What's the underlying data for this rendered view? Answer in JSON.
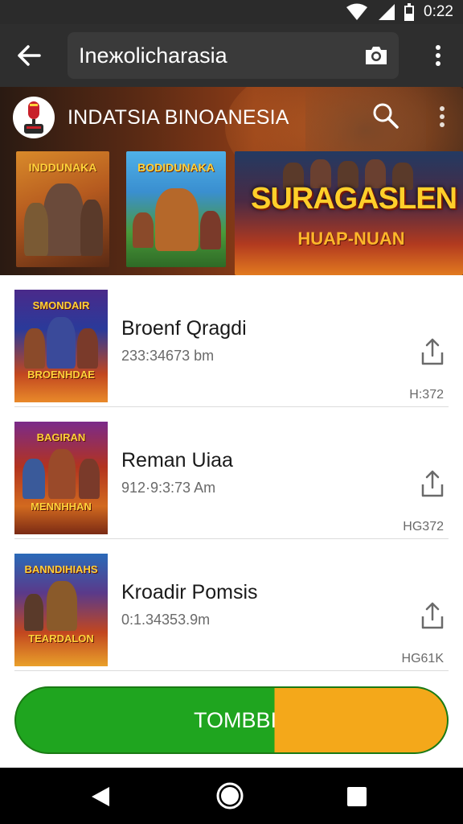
{
  "status_bar": {
    "time": "0:22",
    "icons": [
      "wifi-icon",
      "signal-icon",
      "battery-icon"
    ]
  },
  "app_bar": {
    "search_value": "Ineжolicharasia",
    "icons": [
      "back-arrow-icon",
      "camera-icon",
      "more-vert-icon"
    ]
  },
  "banner": {
    "channel_title": "INDATSIA BINOANESIA",
    "posters": [
      {
        "title": "INDDUNAKA"
      },
      {
        "title": "BODIDUNAKA"
      },
      {
        "title": "SURAGASLEN",
        "subtitle": "HUAP-NUAN"
      }
    ]
  },
  "videos": [
    {
      "title": "Broenf Qragdi",
      "meta": "233:34673 bm",
      "code": "Н:372",
      "thumb_top": "SMONDAIR",
      "thumb_bottom": "BROENHDAE"
    },
    {
      "title": "Reman Uiaa",
      "meta": "912·9:3:73 Am",
      "code": "HG372",
      "thumb_top": "BAGIRAN",
      "thumb_bottom": "MENNHHAN"
    },
    {
      "title": "Kroadir Pomsis",
      "meta": "0:1.34353.9m",
      "code": "HG61K",
      "thumb_top": "BANNDIHIAHS",
      "thumb_bottom": "TEARDALON"
    }
  ],
  "action": {
    "label": "TOMBBI"
  },
  "colors": {
    "accent_green": "#1fa51f",
    "accent_orange": "#f4a81a",
    "app_bar": "#2e2e2e"
  }
}
